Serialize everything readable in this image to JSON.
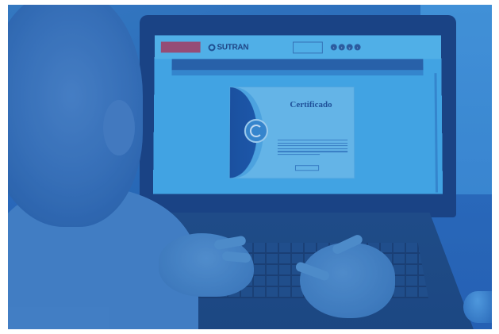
{
  "photo": {
    "subject": "",
    "colors": {
      "tint": "#2c6fbb",
      "screen": "#4ab4ee",
      "header": "#5cc2f3",
      "navbar": "#2b63a8",
      "certificate_band": "#1b4f9c"
    }
  },
  "screen": {
    "header": {
      "gov_badge": "",
      "logo": "SUTRAN",
      "tagline": "",
      "hotline": "",
      "socials": [
        "t",
        "f",
        "y",
        "i"
      ],
      "partner": ""
    },
    "nav": {
      "items": [
        "",
        "",
        "",
        "",
        ""
      ],
      "right_items": [
        "",
        ""
      ]
    },
    "certificate": {
      "title": "Certificado",
      "intro": "",
      "recipient": "",
      "body_lines": 6
    }
  },
  "icons": [
    "logo-mark-icon",
    "seal-icon",
    "twitter-icon",
    "facebook-icon",
    "youtube-icon",
    "instagram-icon"
  ]
}
